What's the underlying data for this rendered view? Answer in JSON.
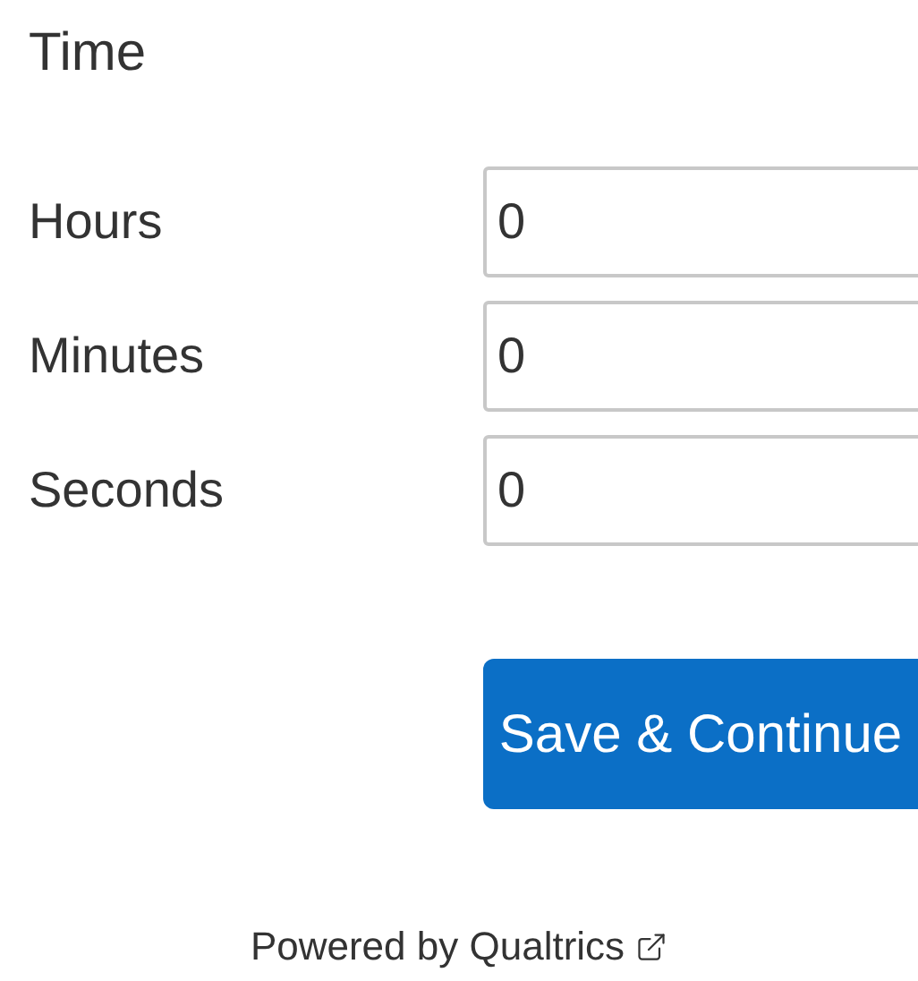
{
  "title": "Time",
  "fields": [
    {
      "label": "Hours",
      "value": "0"
    },
    {
      "label": "Minutes",
      "value": "0"
    },
    {
      "label": "Seconds",
      "value": "0"
    }
  ],
  "button": "Save & Continue",
  "footer": {
    "link": "Powered by Qualtrics"
  }
}
